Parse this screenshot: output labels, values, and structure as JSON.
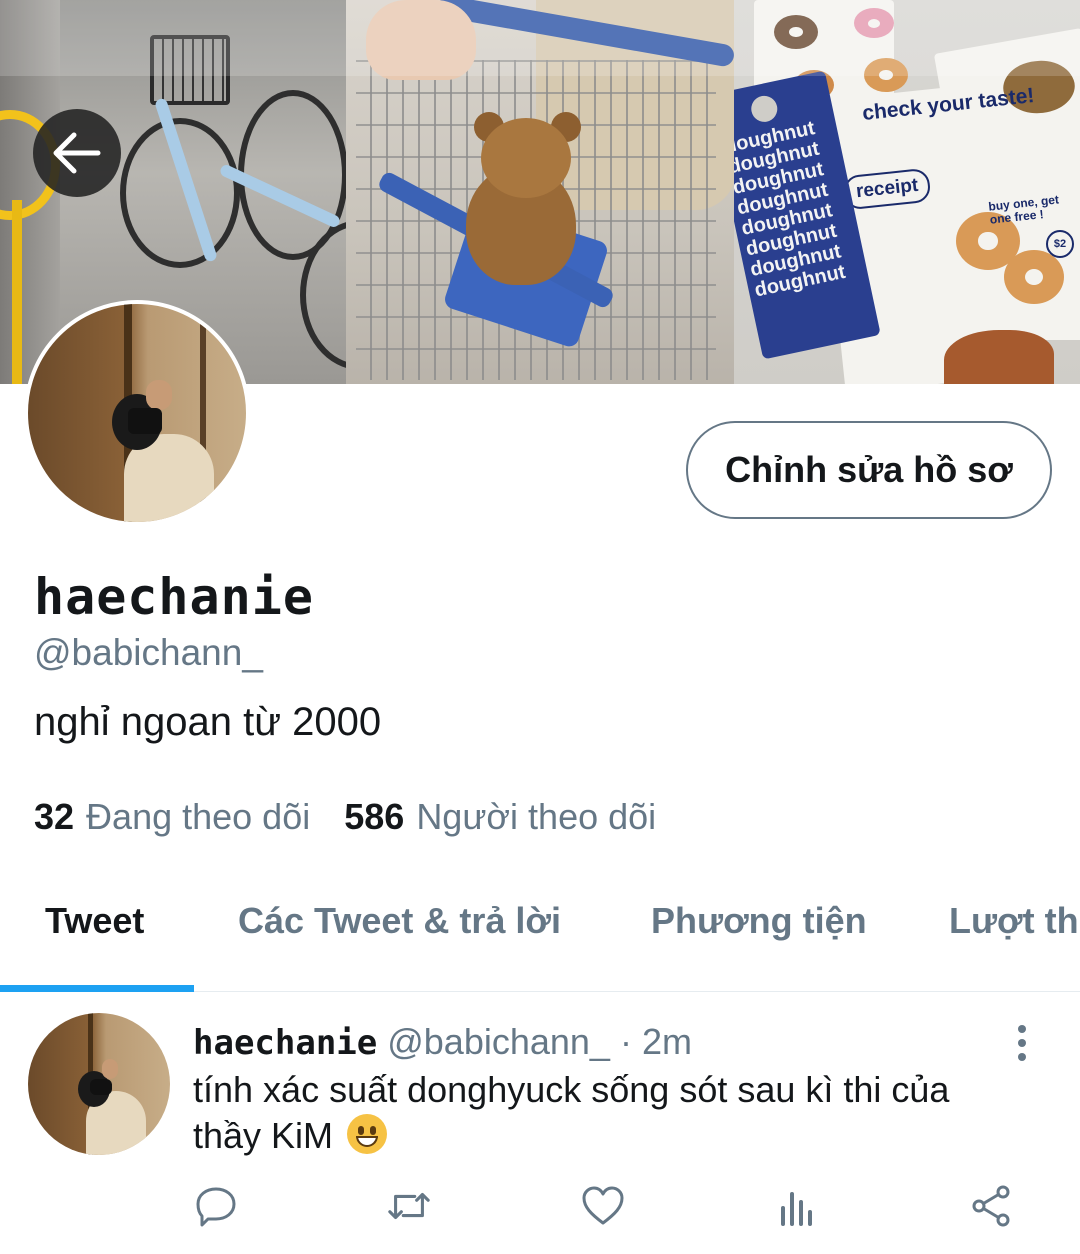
{
  "header": {
    "back_icon": "arrow-left-icon",
    "banner_texts": {
      "tag": "doughnut doughnut doughnut doughnut doughnut doughnut doughnut doughnut",
      "check": "check your taste!",
      "receipt": "receipt",
      "buy_one": "buy one, get one free !",
      "price": "$2"
    }
  },
  "profile": {
    "edit_button_label": "Chỉnh sửa hồ sơ",
    "display_name": "haechanie",
    "handle": "@babichann_",
    "bio": "nghỉ ngoan từ 2000",
    "following_count": "32",
    "following_label": "Đang theo dõi",
    "followers_count": "586",
    "followers_label": "Người theo dõi"
  },
  "tabs": [
    {
      "label": "Tweet",
      "active": true
    },
    {
      "label": "Các Tweet & trả lời",
      "active": false
    },
    {
      "label": "Phương tiện",
      "active": false
    },
    {
      "label": "Lượt thích",
      "active": false
    }
  ],
  "tweet": {
    "name": "haechanie",
    "handle": "@babichann_",
    "dot": "·",
    "time": "2m",
    "text": "tính xác suất donghyuck sống sót sau kì thi của thầy KiM",
    "emoji": "grinning-face-emoji",
    "actions": [
      "reply-icon",
      "retweet-icon",
      "like-icon",
      "analytics-icon",
      "share-icon"
    ]
  },
  "colors": {
    "accent": "#1da1f2",
    "secondary_text": "#657786",
    "primary_text": "#14171a",
    "border": "#e6ecf0"
  }
}
